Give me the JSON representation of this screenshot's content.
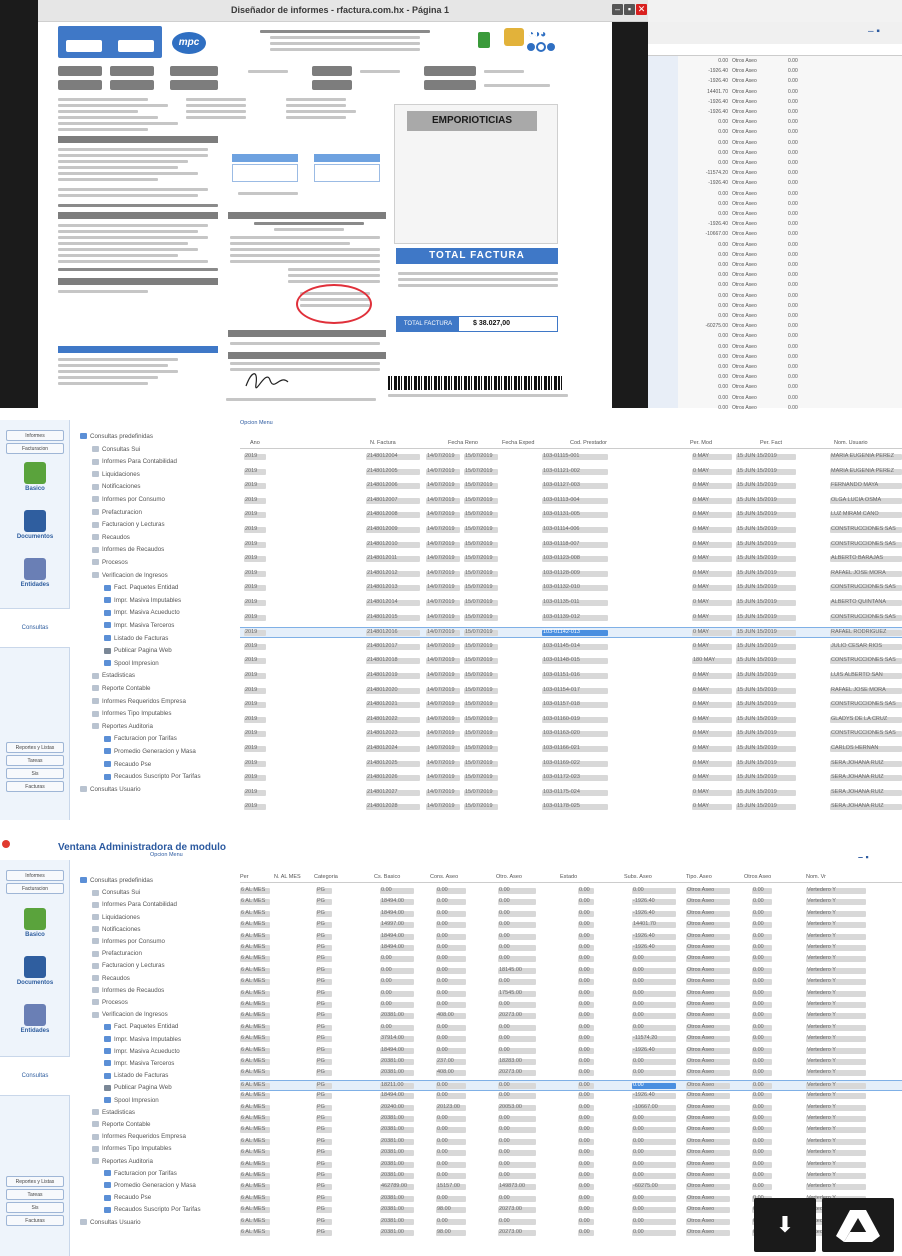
{
  "top_window": {
    "title": "Diseñador de informes - rfactura.com.hx - Página 1",
    "minimize": "–",
    "maximize": "▪",
    "close": "✕"
  },
  "invoice": {
    "logo_text": "mpc",
    "emporiticias_label": "EMPORIOTICIAS",
    "total_factura_banner": "TOTAL FACTURA",
    "total_factura_label": "TOTAL FACTURA",
    "total_factura_value": "$ 38.027,00"
  },
  "top_right_table": {
    "rows": [
      {
        "a": "0.00",
        "b": "Otros Aseo",
        "c": "0.00"
      },
      {
        "a": "-1926.40",
        "b": "Otros Aseo",
        "c": "0.00"
      },
      {
        "a": "-1926.40",
        "b": "Otros Aseo",
        "c": "0.00"
      },
      {
        "a": "14401.70",
        "b": "Otros Aseo",
        "c": "0.00"
      },
      {
        "a": "-1926.40",
        "b": "Otros Aseo",
        "c": "0.00"
      },
      {
        "a": "-1926.40",
        "b": "Otros Aseo",
        "c": "0.00"
      },
      {
        "a": "0.00",
        "b": "Otros Aseo",
        "c": "0.00"
      },
      {
        "a": "0.00",
        "b": "Otros Aseo",
        "c": "0.00"
      },
      {
        "a": "0.00",
        "b": "Otros Aseo",
        "c": "0.00"
      },
      {
        "a": "0.00",
        "b": "Otros Aseo",
        "c": "0.00"
      },
      {
        "a": "0.00",
        "b": "Otros Aseo",
        "c": "0.00"
      },
      {
        "a": "-11574.20",
        "b": "Otros Aseo",
        "c": "0.00"
      },
      {
        "a": "-1926.40",
        "b": "Otros Aseo",
        "c": "0.00"
      },
      {
        "a": "0.00",
        "b": "Otros Aseo",
        "c": "0.00"
      },
      {
        "a": "0.00",
        "b": "Otros Aseo",
        "c": "0.00"
      },
      {
        "a": "0.00",
        "b": "Otros Aseo",
        "c": "0.00"
      },
      {
        "a": "-1926.40",
        "b": "Otros Aseo",
        "c": "0.00"
      },
      {
        "a": "-10667.00",
        "b": "Otros Aseo",
        "c": "0.00"
      },
      {
        "a": "0.00",
        "b": "Otros Aseo",
        "c": "0.00"
      },
      {
        "a": "0.00",
        "b": "Otros Aseo",
        "c": "0.00"
      },
      {
        "a": "0.00",
        "b": "Otros Aseo",
        "c": "0.00"
      },
      {
        "a": "0.00",
        "b": "Otros Aseo",
        "c": "0.00"
      },
      {
        "a": "0.00",
        "b": "Otros Aseo",
        "c": "0.00"
      },
      {
        "a": "0.00",
        "b": "Otros Aseo",
        "c": "0.00"
      },
      {
        "a": "0.00",
        "b": "Otros Aseo",
        "c": "0.00"
      },
      {
        "a": "0.00",
        "b": "Otros Aseo",
        "c": "0.00"
      },
      {
        "a": "-60275.00",
        "b": "Otros Aseo",
        "c": "0.00"
      },
      {
        "a": "0.00",
        "b": "Otros Aseo",
        "c": "0.00"
      },
      {
        "a": "0.00",
        "b": "Otros Aseo",
        "c": "0.00"
      },
      {
        "a": "0.00",
        "b": "Otros Aseo",
        "c": "0.00"
      },
      {
        "a": "0.00",
        "b": "Otros Aseo",
        "c": "0.00"
      },
      {
        "a": "0.00",
        "b": "Otros Aseo",
        "c": "0.00"
      },
      {
        "a": "0.00",
        "b": "Otros Aseo",
        "c": "0.00"
      },
      {
        "a": "0.00",
        "b": "Otros Aseo",
        "c": "0.00"
      },
      {
        "a": "0.00",
        "b": "Otros Aseo",
        "c": "0.00"
      }
    ]
  },
  "sidebar": {
    "top_buttons": [
      "Informes",
      "Facturacion"
    ],
    "icons": [
      {
        "label": "Basico",
        "color": "#5aa33c"
      },
      {
        "label": "Documentos",
        "color": "#2f5e9f"
      },
      {
        "label": "Entidades",
        "color": "#6a7fb5"
      }
    ],
    "active_label": "Consultas",
    "bottom_buttons": [
      "Reportes y Listas",
      "Tareas",
      "Sis",
      "Facturas"
    ]
  },
  "tree_mid": {
    "menu_label": "Opcion Menu",
    "items": [
      {
        "label": "Consultas predefinidas",
        "indent": 0,
        "icon": "folder"
      },
      {
        "label": "Consultas Sui",
        "indent": 1,
        "icon": "node"
      },
      {
        "label": "Informes Para Contabilidad",
        "indent": 1,
        "icon": "node"
      },
      {
        "label": "Liquidaciones",
        "indent": 1,
        "icon": "node"
      },
      {
        "label": "Notificaciones",
        "indent": 1,
        "icon": "node"
      },
      {
        "label": "Informes por Consumo",
        "indent": 1,
        "icon": "node"
      },
      {
        "label": "Prefacturacion",
        "indent": 1,
        "icon": "node"
      },
      {
        "label": "Facturacion y Lecturas",
        "indent": 1,
        "icon": "node"
      },
      {
        "label": "Recaudos",
        "indent": 1,
        "icon": "node"
      },
      {
        "label": "Informes de Recaudos",
        "indent": 1,
        "icon": "node"
      },
      {
        "label": "Procesos",
        "indent": 1,
        "icon": "node"
      },
      {
        "label": "Verificacion de Ingresos",
        "indent": 1,
        "icon": "node"
      },
      {
        "label": "Fact. Paquetes Entidad",
        "indent": 2,
        "icon": "doc"
      },
      {
        "label": "Impr. Masiva Imputables",
        "indent": 2,
        "icon": "doc"
      },
      {
        "label": "Impr. Masiva Acueducto",
        "indent": 2,
        "icon": "doc"
      },
      {
        "label": "Impr. Masiva Terceros",
        "indent": 2,
        "icon": "doc"
      },
      {
        "label": "Listado de Facturas",
        "indent": 2,
        "icon": "doc"
      },
      {
        "label": "Publicar Pagina Web",
        "indent": 2,
        "icon": "pin"
      },
      {
        "label": "Spool Impresion",
        "indent": 2,
        "icon": "doc"
      },
      {
        "label": "Estadisticas",
        "indent": 1,
        "icon": "node"
      },
      {
        "label": "Reporte Contable",
        "indent": 1,
        "icon": "node"
      },
      {
        "label": "Informes Requeridos Empresa",
        "indent": 1,
        "icon": "node"
      },
      {
        "label": "Informes Tipo Imputables",
        "indent": 1,
        "icon": "node"
      },
      {
        "label": "Reportes Auditoria",
        "indent": 1,
        "icon": "node"
      },
      {
        "label": "Facturacion por Tarifas",
        "indent": 2,
        "icon": "doc"
      },
      {
        "label": "Promedio Generacion y Masa",
        "indent": 2,
        "icon": "doc"
      },
      {
        "label": "Recaudo Pse",
        "indent": 2,
        "icon": "doc"
      },
      {
        "label": "Recaudos Suscripto Por Tarifas",
        "indent": 2,
        "icon": "doc"
      },
      {
        "label": "Consultas Usuario",
        "indent": 0,
        "icon": "node"
      }
    ]
  },
  "mid_grid": {
    "headers": [
      "Ano",
      "N. Factura",
      "Fecha Reno",
      "Fecha Exped",
      "Cod. Prestador",
      "Per. Mod",
      "Per. Fact",
      "Nom. Usuario"
    ],
    "rows": [
      {
        "ano": "2019",
        "fact": "2148012004",
        "f1": "14/07/2019",
        "f2": "15/07/2019",
        "cod": "103-01115-001",
        "per": "0 MAY",
        "pf": "15 JUN 15/2019",
        "nom": "MARIA EUGENIA PEREZ"
      },
      {
        "ano": "2019",
        "fact": "2148012005",
        "f1": "14/07/2019",
        "f2": "15/07/2019",
        "cod": "103-01121-002",
        "per": "0 MAY",
        "pf": "15 JUN 15/2019",
        "nom": "MARIA EUGENIA PEREZ"
      },
      {
        "ano": "2019",
        "fact": "2148012006",
        "f1": "14/07/2019",
        "f2": "15/07/2019",
        "cod": "103-01127-003",
        "per": "0 MAY",
        "pf": "15 JUN 15/2019",
        "nom": "FERNANDO MAYA"
      },
      {
        "ano": "2019",
        "fact": "2148012007",
        "f1": "14/07/2019",
        "f2": "15/07/2019",
        "cod": "103-01113-004",
        "per": "0 MAY",
        "pf": "15 JUN 15/2019",
        "nom": "OLGA LUCIA OSMA"
      },
      {
        "ano": "2019",
        "fact": "2148012008",
        "f1": "14/07/2019",
        "f2": "15/07/2019",
        "cod": "103-01131-005",
        "per": "0 MAY",
        "pf": "15 JUN 15/2019",
        "nom": "LUZ MIRAM CANO"
      },
      {
        "ano": "2019",
        "fact": "2148012009",
        "f1": "14/07/2019",
        "f2": "15/07/2019",
        "cod": "103-01114-006",
        "per": "0 MAY",
        "pf": "15 JUN 15/2019",
        "nom": "CONSTRUCCIONES SAS"
      },
      {
        "ano": "2019",
        "fact": "2148012010",
        "f1": "14/07/2019",
        "f2": "15/07/2019",
        "cod": "103-01118-007",
        "per": "0 MAY",
        "pf": "15 JUN 15/2019",
        "nom": "CONSTRUCCIONES SAS"
      },
      {
        "ano": "2019",
        "fact": "2148012011",
        "f1": "14/07/2019",
        "f2": "15/07/2019",
        "cod": "103-01123-008",
        "per": "0 MAY",
        "pf": "15 JUN 15/2019",
        "nom": "ALBERTO BARAJAS"
      },
      {
        "ano": "2019",
        "fact": "2148012012",
        "f1": "14/07/2019",
        "f2": "15/07/2019",
        "cod": "103-01128-009",
        "per": "0 MAY",
        "pf": "15 JUN 15/2019",
        "nom": "RAFAEL JOSE MORA"
      },
      {
        "ano": "2019",
        "fact": "2148012013",
        "f1": "14/07/2019",
        "f2": "15/07/2019",
        "cod": "103-01132-010",
        "per": "0 MAY",
        "pf": "15 JUN 15/2019",
        "nom": "CONSTRUCCIONES SAS"
      },
      {
        "ano": "2019",
        "fact": "2148012014",
        "f1": "14/07/2019",
        "f2": "15/07/2019",
        "cod": "103-01135-011",
        "per": "0 MAY",
        "pf": "15 JUN 15/2019",
        "nom": "ALBERTO QUINTANA"
      },
      {
        "ano": "2019",
        "fact": "2148012015",
        "f1": "14/07/2019",
        "f2": "15/07/2019",
        "cod": "103-01139-012",
        "per": "0 MAY",
        "pf": "15 JUN 15/2019",
        "nom": "CONSTRUCCIONES SAS"
      },
      {
        "ano": "2019",
        "fact": "2148012016",
        "f1": "14/07/2019",
        "f2": "15/07/2019",
        "cod": "103-01142-013",
        "per": "0 MAY",
        "pf": "15 JUN 15/2019",
        "nom": "RAFAEL RODRIGUEZ"
      },
      {
        "ano": "2019",
        "fact": "2148012017",
        "f1": "14/07/2019",
        "f2": "15/07/2019",
        "cod": "103-01145-014",
        "per": "0 MAY",
        "pf": "15 JUN 15/2019",
        "nom": "JULIO CESAR RIOS"
      },
      {
        "ano": "2019",
        "fact": "2148012018",
        "f1": "14/07/2019",
        "f2": "15/07/2019",
        "cod": "103-01148-015",
        "per": "180 MAY",
        "pf": "15 JUN 15/2019",
        "nom": "CONSTRUCCIONES SAS"
      },
      {
        "ano": "2019",
        "fact": "2148012019",
        "f1": "14/07/2019",
        "f2": "15/07/2019",
        "cod": "103-01151-016",
        "per": "0 MAY",
        "pf": "15 JUN 15/2019",
        "nom": "LUIS ALBERTO SAN"
      },
      {
        "ano": "2019",
        "fact": "2148012020",
        "f1": "14/07/2019",
        "f2": "15/07/2019",
        "cod": "103-01154-017",
        "per": "0 MAY",
        "pf": "15 JUN 15/2019",
        "nom": "RAFAEL JOSE MORA"
      },
      {
        "ano": "2019",
        "fact": "2148012021",
        "f1": "14/07/2019",
        "f2": "15/07/2019",
        "cod": "103-01157-018",
        "per": "0 MAY",
        "pf": "15 JUN 15/2019",
        "nom": "CONSTRUCCIONES SAS"
      },
      {
        "ano": "2019",
        "fact": "2148012022",
        "f1": "14/07/2019",
        "f2": "15/07/2019",
        "cod": "103-01160-019",
        "per": "0 MAY",
        "pf": "15 JUN 15/2019",
        "nom": "GLADYS DE LA CRUZ"
      },
      {
        "ano": "2019",
        "fact": "2148012023",
        "f1": "14/07/2019",
        "f2": "15/07/2019",
        "cod": "103-01163-020",
        "per": "0 MAY",
        "pf": "15 JUN 15/2019",
        "nom": "CONSTRUCCIONES SAS"
      },
      {
        "ano": "2019",
        "fact": "2148012024",
        "f1": "14/07/2019",
        "f2": "15/07/2019",
        "cod": "103-01166-021",
        "per": "0 MAY",
        "pf": "15 JUN 15/2019",
        "nom": "CARLOS HERNAN"
      },
      {
        "ano": "2019",
        "fact": "2148012025",
        "f1": "14/07/2019",
        "f2": "15/07/2019",
        "cod": "103-01169-022",
        "per": "0 MAY",
        "pf": "15 JUN 15/2019",
        "nom": "SERA JOHANA RUIZ"
      },
      {
        "ano": "2019",
        "fact": "2148012026",
        "f1": "14/07/2019",
        "f2": "15/07/2019",
        "cod": "103-01172-023",
        "per": "0 MAY",
        "pf": "15 JUN 15/2019",
        "nom": "SERA JOHANA RUIZ"
      },
      {
        "ano": "2019",
        "fact": "2148012027",
        "f1": "14/07/2019",
        "f2": "15/07/2019",
        "cod": "103-01175-024",
        "per": "0 MAY",
        "pf": "15 JUN 15/2019",
        "nom": "SERA JOHANA RUIZ"
      },
      {
        "ano": "2019",
        "fact": "2148012028",
        "f1": "14/07/2019",
        "f2": "15/07/2019",
        "cod": "103-01178-025",
        "per": "0 MAY",
        "pf": "15 JUN 15/2019",
        "nom": "SERA JOHANA RUIZ"
      }
    ],
    "highlight_row_index": 12
  },
  "bottom_window": {
    "title": "Ventana Administradora de modulo",
    "menu_label": "Opcion Menu",
    "win_buttons": "– ▪",
    "sidebar_top": [
      "Informes",
      "Facturacion"
    ],
    "active_label": "Consultas",
    "sidebar_bottom": [
      "Reportes y Listas",
      "Tareas",
      "Sis",
      "Facturas"
    ],
    "headers": [
      "Per",
      "N. AL MES",
      "Categoria",
      "Cs. Basico",
      "Cons. Aseo",
      "Otro. Aseo",
      "Estado",
      "Subs. Aseo",
      "Tipo. Aseo",
      "Otros Aseo",
      "Nom. Vr"
    ],
    "rows": [
      {
        "per": "6 AL MES",
        "cat": "PG",
        "v1": "0.00",
        "v2": "0.00",
        "v3": "0.00",
        "v4": "0.00",
        "v5": "0.00"
      },
      {
        "per": "6 AL MES",
        "cat": "PG",
        "v1": "18494.00",
        "v2": "0.00",
        "v3": "0.00",
        "v4": "0.00",
        "v5": "-1926.40"
      },
      {
        "per": "6 AL MES",
        "cat": "PG",
        "v1": "18494.00",
        "v2": "0.00",
        "v3": "0.00",
        "v4": "0.00",
        "v5": "-1926.40"
      },
      {
        "per": "6 AL MES",
        "cat": "PG",
        "v1": "14997.00",
        "v2": "0.00",
        "v3": "0.00",
        "v4": "0.00",
        "v5": "14401.70"
      },
      {
        "per": "6 AL MES",
        "cat": "PG",
        "v1": "18494.00",
        "v2": "0.00",
        "v3": "0.00",
        "v4": "0.00",
        "v5": "-1926.40"
      },
      {
        "per": "6 AL MES",
        "cat": "PG",
        "v1": "18494.00",
        "v2": "0.00",
        "v3": "0.00",
        "v4": "0.00",
        "v5": "-1926.40"
      },
      {
        "per": "6 AL MES",
        "cat": "PG",
        "v1": "0.00",
        "v2": "0.00",
        "v3": "0.00",
        "v4": "0.00",
        "v5": "0.00"
      },
      {
        "per": "6 AL MES",
        "cat": "PG",
        "v1": "0.00",
        "v2": "0.00",
        "v3": "18145.00",
        "v4": "0.00",
        "v5": "0.00"
      },
      {
        "per": "6 AL MES",
        "cat": "PG",
        "v1": "0.00",
        "v2": "0.00",
        "v3": "0.00",
        "v4": "0.00",
        "v5": "0.00"
      },
      {
        "per": "6 AL MES",
        "cat": "PG",
        "v1": "0.00",
        "v2": "0.00",
        "v3": "17545.00",
        "v4": "0.00",
        "v5": "0.00"
      },
      {
        "per": "6 AL MES",
        "cat": "PG",
        "v1": "0.00",
        "v2": "0.00",
        "v3": "0.00",
        "v4": "0.00",
        "v5": "0.00"
      },
      {
        "per": "6 AL MES",
        "cat": "PG",
        "v1": "20381.00",
        "v2": "408.00",
        "v3": "20273.00",
        "v4": "0.00",
        "v5": "0.00"
      },
      {
        "per": "6 AL MES",
        "cat": "PG",
        "v1": "0.00",
        "v2": "0.00",
        "v3": "0.00",
        "v4": "0.00",
        "v5": "0.00"
      },
      {
        "per": "6 AL MES",
        "cat": "PG",
        "v1": "37914.00",
        "v2": "0.00",
        "v3": "0.00",
        "v4": "0.00",
        "v5": "-11574.20"
      },
      {
        "per": "6 AL MES",
        "cat": "PG",
        "v1": "18494.00",
        "v2": "0.00",
        "v3": "0.00",
        "v4": "0.00",
        "v5": "-1926.40"
      },
      {
        "per": "6 AL MES",
        "cat": "PG",
        "v1": "20381.00",
        "v2": "237.00",
        "v3": "18283.00",
        "v4": "0.00",
        "v5": "0.00"
      },
      {
        "per": "6 AL MES",
        "cat": "PG",
        "v1": "20381.00",
        "v2": "408.00",
        "v3": "20273.00",
        "v4": "0.00",
        "v5": "0.00"
      },
      {
        "per": "6 AL MES",
        "cat": "PG",
        "v1": "18211.00",
        "v2": "0.00",
        "v3": "0.00",
        "v4": "0.00",
        "v5": "0.00"
      },
      {
        "per": "6 AL MES",
        "cat": "PG",
        "v1": "18494.00",
        "v2": "0.00",
        "v3": "0.00",
        "v4": "0.00",
        "v5": "-1926.40"
      },
      {
        "per": "6 AL MES",
        "cat": "PG",
        "v1": "20240.00",
        "v2": "20123.00",
        "v3": "20053.00",
        "v4": "0.00",
        "v5": "-10667.00"
      },
      {
        "per": "6 AL MES",
        "cat": "PG",
        "v1": "20381.00",
        "v2": "0.00",
        "v3": "0.00",
        "v4": "0.00",
        "v5": "0.00"
      },
      {
        "per": "6 AL MES",
        "cat": "PG",
        "v1": "20381.00",
        "v2": "0.00",
        "v3": "0.00",
        "v4": "0.00",
        "v5": "0.00"
      },
      {
        "per": "6 AL MES",
        "cat": "PG",
        "v1": "20381.00",
        "v2": "0.00",
        "v3": "0.00",
        "v4": "0.00",
        "v5": "0.00"
      },
      {
        "per": "6 AL MES",
        "cat": "PG",
        "v1": "20381.00",
        "v2": "0.00",
        "v3": "0.00",
        "v4": "0.00",
        "v5": "0.00"
      },
      {
        "per": "6 AL MES",
        "cat": "PG",
        "v1": "20381.00",
        "v2": "0.00",
        "v3": "0.00",
        "v4": "0.00",
        "v5": "0.00"
      },
      {
        "per": "6 AL MES",
        "cat": "PG",
        "v1": "20381.00",
        "v2": "0.00",
        "v3": "0.00",
        "v4": "0.00",
        "v5": "0.00"
      },
      {
        "per": "6 AL MES",
        "cat": "PG",
        "v1": "462789.00",
        "v2": "15157.00",
        "v3": "149873.00",
        "v4": "0.00",
        "v5": "-60275.00"
      },
      {
        "per": "6 AL MES",
        "cat": "PG",
        "v1": "20381.00",
        "v2": "0.00",
        "v3": "0.00",
        "v4": "0.00",
        "v5": "0.00"
      },
      {
        "per": "6 AL MES",
        "cat": "PG",
        "v1": "20381.00",
        "v2": "98.00",
        "v3": "20273.00",
        "v4": "0.00",
        "v5": "0.00"
      },
      {
        "per": "6 AL MES",
        "cat": "PG",
        "v1": "20381.00",
        "v2": "0.00",
        "v3": "0.00",
        "v4": "0.00",
        "v5": "0.00"
      },
      {
        "per": "6 AL MES",
        "cat": "PG",
        "v1": "20381.00",
        "v2": "98.00",
        "v3": "20273.00",
        "v4": "0.00",
        "v5": "0.00"
      }
    ],
    "highlight_row_index": 17
  },
  "fabs": {
    "download_icon": "⬇",
    "drive_icon": "drive-icon"
  }
}
